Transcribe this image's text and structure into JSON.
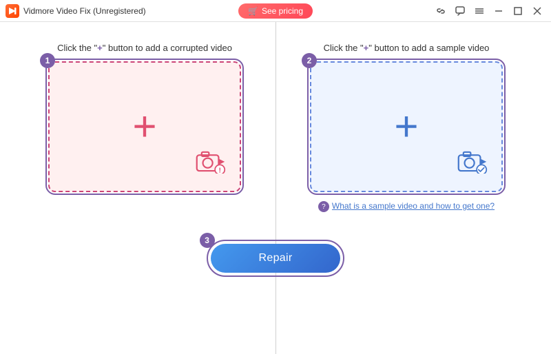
{
  "titleBar": {
    "title": "Vidmore Video Fix (Unregistered)",
    "pricingBtn": "See pricing",
    "icons": {
      "link": "🔗",
      "chat": "💬",
      "menu": "☰",
      "minimize": "—",
      "maximize": "□",
      "close": "✕"
    }
  },
  "leftPanel": {
    "label_pre": "Click the \"",
    "label_plus": "+",
    "label_post": "\" button to add a corrupted video",
    "badge": "1",
    "ariaLabel": "Add corrupted video drop zone"
  },
  "rightPanel": {
    "label_pre": "Click the \"",
    "label_plus": "+",
    "label_post": "\" button to add a sample video",
    "badge": "2",
    "ariaLabel": "Add sample video drop zone",
    "sampleLinkText": "What is a sample video and how to get one?"
  },
  "repairSection": {
    "badge": "3",
    "buttonLabel": "Repair"
  }
}
